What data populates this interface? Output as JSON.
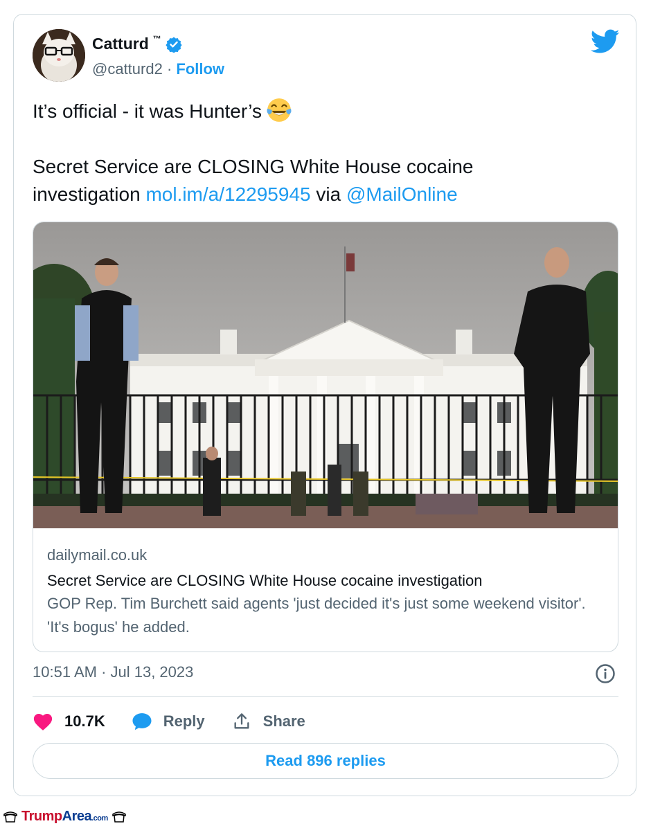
{
  "tweet": {
    "author_name": "Catturd",
    "author_tm": "™",
    "handle": "@catturd2",
    "separator": " · ",
    "follow_label": "Follow",
    "text_line1": "It’s official - it was Hunter’s",
    "text_line3_a": "Secret Service are CLOSING White House cocaine",
    "text_line4_a": "investigation ",
    "link_url": "mol.im/a/12295945",
    "text_line4_via": " via ",
    "mention": "@MailOnline",
    "timestamp": "10:51 AM · Jul 13, 2023"
  },
  "preview": {
    "domain": "dailymail.co.uk",
    "title": "Secret Service are CLOSING White House cocaine investigation",
    "description": "GOP Rep. Tim Burchett said agents 'just decided it's just some weekend visitor'. 'It's bogus' he added."
  },
  "actions": {
    "likes": "10.7K",
    "reply_label": "Reply",
    "share_label": "Share"
  },
  "read_replies_label": "Read 896 replies",
  "watermark": {
    "part1": "Trump",
    "part2": "Area",
    "part3": ".com"
  },
  "icons": {
    "brand": "twitter-bird-icon",
    "verified": "verified-badge-icon",
    "emoji": "tears-of-joy-emoji",
    "info": "info-icon",
    "like": "heart-icon",
    "reply": "speech-bubble-icon",
    "share": "share-upload-icon"
  },
  "colors": {
    "link": "#1d9bf0",
    "heart": "#f91880",
    "text": "#0f1419",
    "muted": "#536471",
    "border": "#cfd9de"
  }
}
